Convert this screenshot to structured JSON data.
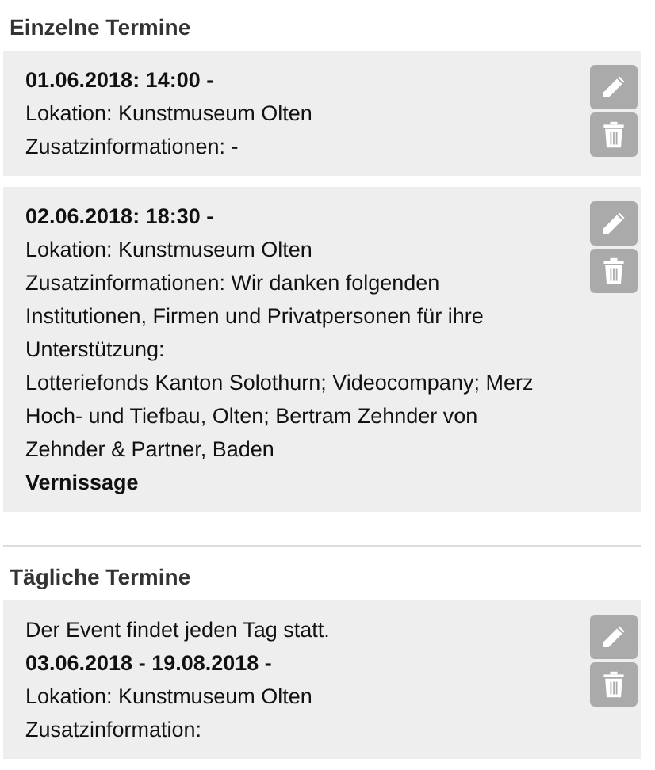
{
  "sections": [
    {
      "heading": "Einzelne Termine",
      "entries": [
        {
          "lines": [
            {
              "kind": "bold",
              "text": "01.06.2018: 14:00 -"
            },
            {
              "kind": "text",
              "text": "Lokation: Kunstmuseum Olten"
            },
            {
              "kind": "text",
              "text": "Zusatzinformationen: -"
            }
          ]
        },
        {
          "lines": [
            {
              "kind": "bold",
              "text": "02.06.2018: 18:30 -"
            },
            {
              "kind": "text",
              "text": "Lokation: Kunstmuseum Olten"
            },
            {
              "kind": "text",
              "text": "Zusatzinformationen: Wir danken folgenden Institutionen, Firmen und Privatpersonen für ihre Unterstützung:"
            },
            {
              "kind": "text",
              "text": "Lotteriefonds Kanton Solothurn; Videocompany; Merz Hoch- und Tiefbau, Olten; Bertram Zehnder von Zehnder & Partner, Baden"
            },
            {
              "kind": "bold",
              "text": "Vernissage"
            }
          ]
        }
      ]
    },
    {
      "heading": "Tägliche Termine",
      "entries": [
        {
          "lines": [
            {
              "kind": "text",
              "text": "Der Event findet jeden Tag statt."
            },
            {
              "kind": "bold",
              "text": "03.06.2018 - 19.08.2018 -"
            },
            {
              "kind": "text",
              "text": "Lokation: Kunstmuseum Olten"
            },
            {
              "kind": "text",
              "text": "Zusatzinformation:"
            }
          ]
        }
      ]
    }
  ]
}
